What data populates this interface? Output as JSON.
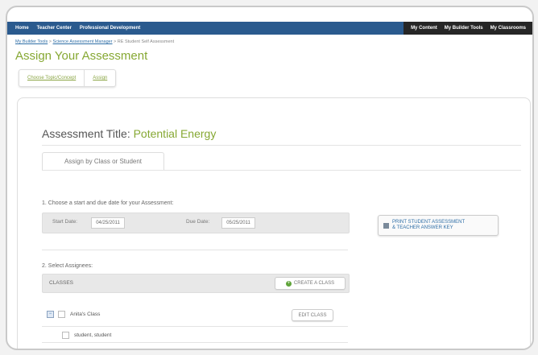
{
  "nav": {
    "left": [
      "Home",
      "Teacher Center",
      "Professional Development"
    ],
    "right": [
      "My Content",
      "My Builder Tools",
      "My Classrooms"
    ]
  },
  "breadcrumb": {
    "link1": "My Builder Tools",
    "sep1": " > ",
    "link2": "Science Assessment Manager",
    "sep2": " > ",
    "current": "RE Student Self Assessment"
  },
  "page_title": "Assign Your Assessment",
  "steps": [
    "Choose Topic/Concept",
    "Assign"
  ],
  "assessment": {
    "title_label": "Assessment Title:",
    "title_value": "Potential Energy"
  },
  "tab_label": "Assign by Class or Student",
  "dates_section": {
    "instruction": "1. Choose a start and due date for your Assessment:",
    "start_label": "Start Date:",
    "start_value": "04/25/2011",
    "due_label": "Due Date:",
    "due_value": "05/25/2011"
  },
  "print_button": {
    "line1": "PRINT STUDENT ASSESSMENT",
    "line2": "& TEACHER ANSWER KEY"
  },
  "assignees": {
    "instruction": "2. Select Assignees:",
    "header": "CLASSES",
    "create_button": "CREATE A CLASS",
    "class_name": "Anita's Class",
    "edit_button": "EDIT CLASS",
    "student": "student, student"
  },
  "colors": {
    "accent_green": "#86a833",
    "nav_blue": "#2a5a8e",
    "link_blue": "#2e6ea6"
  }
}
